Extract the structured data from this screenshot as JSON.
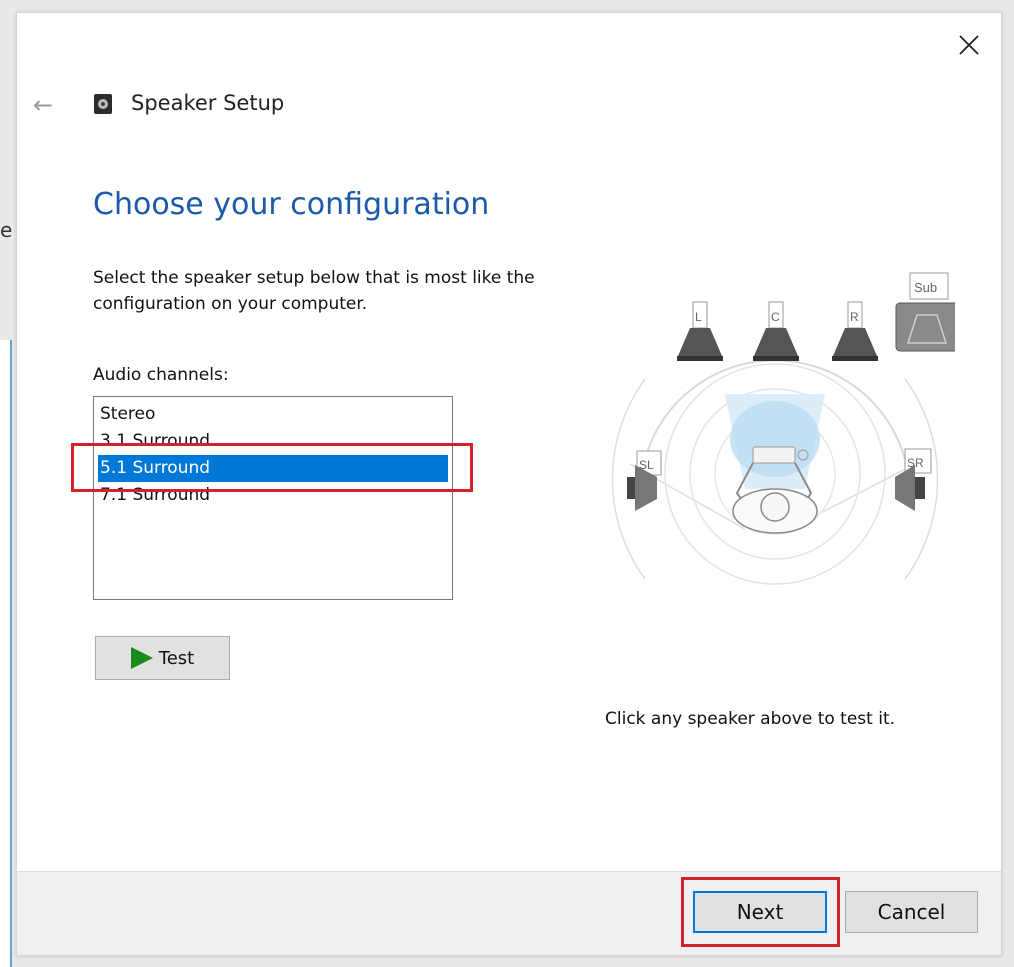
{
  "background": {
    "partial_char": "e"
  },
  "dialog": {
    "title": "Speaker Setup",
    "heading": "Choose your configuration",
    "instructions": "Select the speaker setup below that is most like the configuration on your computer.",
    "channels_label": "Audio channels:",
    "channels": [
      {
        "label": "Stereo",
        "selected": false
      },
      {
        "label": "3.1 Surround",
        "selected": false
      },
      {
        "label": "5.1 Surround",
        "selected": true
      },
      {
        "label": "7.1 Surround",
        "selected": false
      }
    ],
    "test_label": "Test",
    "hint": "Click any speaker above to test it.",
    "speakers": {
      "left": "L",
      "center": "C",
      "right": "R",
      "sub": "Sub",
      "surround_left": "SL",
      "surround_right": "SR"
    },
    "next_label": "Next",
    "cancel_label": "Cancel"
  },
  "colors": {
    "accent": "#0078d7",
    "heading": "#1b5aa6",
    "highlight": "#d2232a",
    "play": "#1a8a1a"
  },
  "icons": {
    "close": "close-icon",
    "back": "back-arrow-icon",
    "app": "speaker-icon",
    "play": "play-icon"
  }
}
